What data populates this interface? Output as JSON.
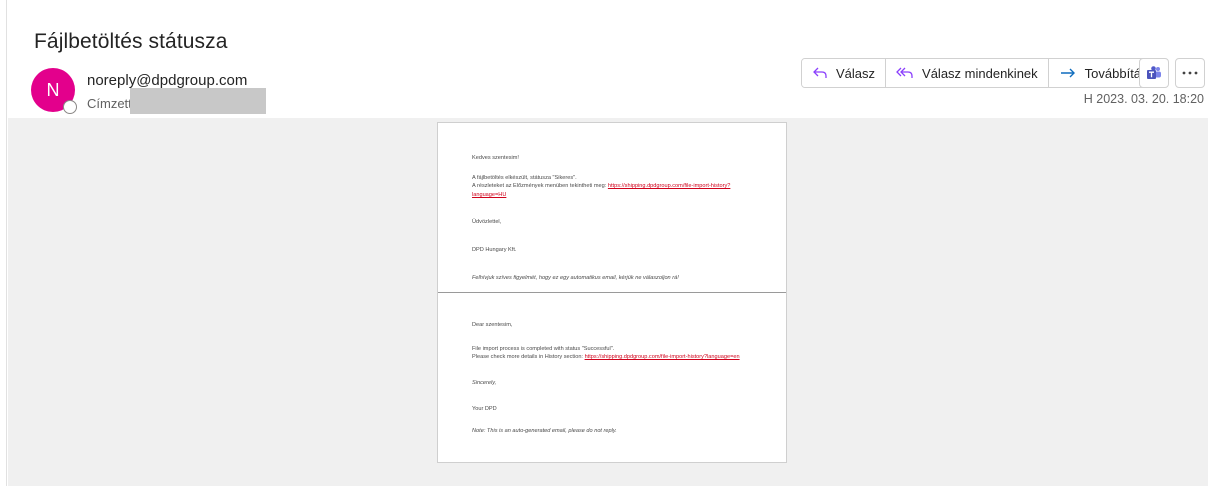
{
  "email": {
    "subject": "Fájlbetöltés státusza",
    "sender": "noreply@dpdgroup.com",
    "avatar_initial": "N",
    "avatar_color": "#e3008c",
    "to_label": "Címzett",
    "date": "H 2023. 03. 20. 18:20"
  },
  "actions": {
    "reply": "Válasz",
    "reply_all": "Válasz mindenkinek",
    "forward": "Továbbítás"
  },
  "body": {
    "hu": {
      "greeting": "Kedves szentesim!",
      "line1": "A fájlbetöltés elkészült, státusza \"Sikeres\".",
      "line2": "A részleteket az Előzmények menüben tekintheti meg:",
      "link_part1": "https://shipping.dpdgroup.com/file-import-history?",
      "link_part2": "language=HU",
      "regards": "Üdvözlettel,",
      "signature": "DPD Hungary Kft.",
      "note": "Felhívjuk szíves figyelmét, hogy ez egy automatikus email, kérjük ne válaszoljon rá!"
    },
    "en": {
      "greeting": "Dear szentesim,",
      "line1": "File import process is completed with status \"Successful\".",
      "line2": "Please check more details in History section:",
      "link": "https://shipping.dpdgroup.com/file-import-history?language=en",
      "regards": "Sincerely,",
      "signature": "Your DPD",
      "note": "Note: This is an auto-generated email, please do not reply."
    }
  }
}
